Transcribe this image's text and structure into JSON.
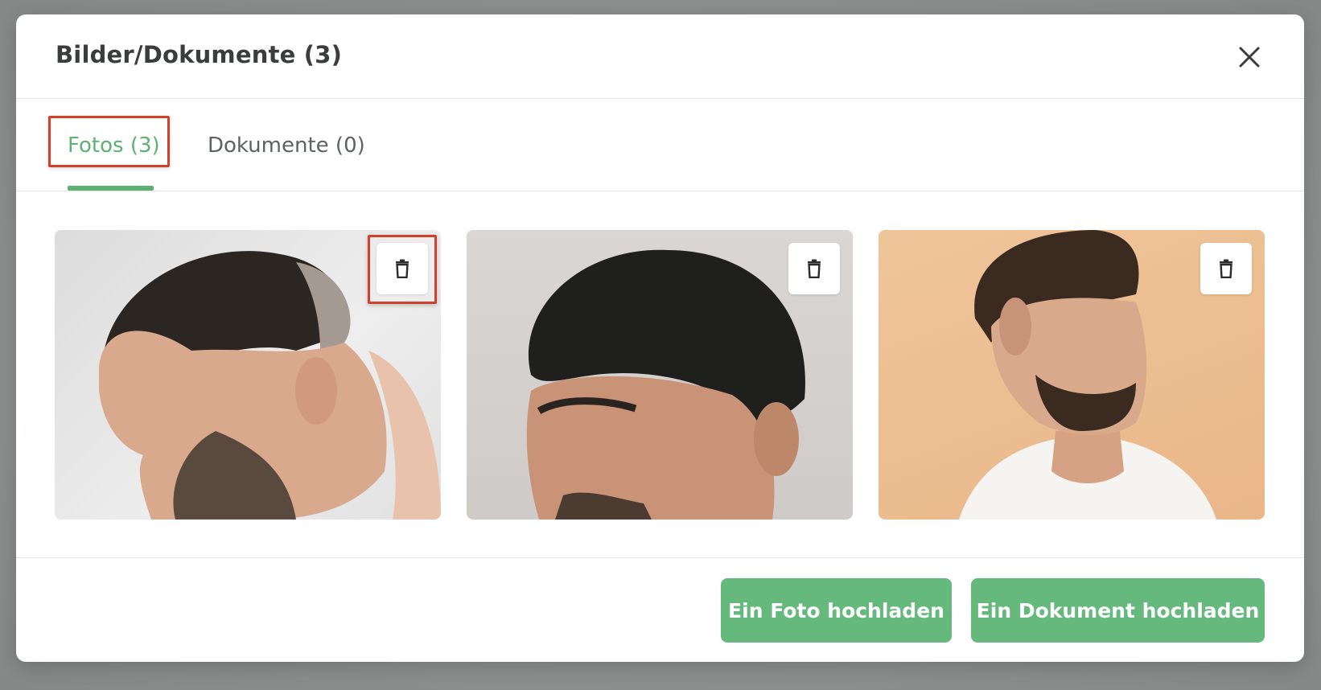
{
  "modal": {
    "title": "Bilder/Dokumente (3)",
    "close_icon": "close-icon"
  },
  "tabs": [
    {
      "label": "Fotos (3)",
      "active": true
    },
    {
      "label": "Dokumente (0)",
      "active": false
    }
  ],
  "photos": [
    {
      "alt": "photo-1",
      "delete_icon": "trash-icon"
    },
    {
      "alt": "photo-2",
      "delete_icon": "trash-icon"
    },
    {
      "alt": "photo-3",
      "delete_icon": "trash-icon"
    }
  ],
  "footer": {
    "upload_photo_label": "Ein Foto hochladen",
    "upload_document_label": "Ein Dokument hochladen"
  },
  "colors": {
    "accent": "#5cb173",
    "button": "#66b97d",
    "highlight": "#d0402c",
    "title": "#3a3d3c"
  }
}
